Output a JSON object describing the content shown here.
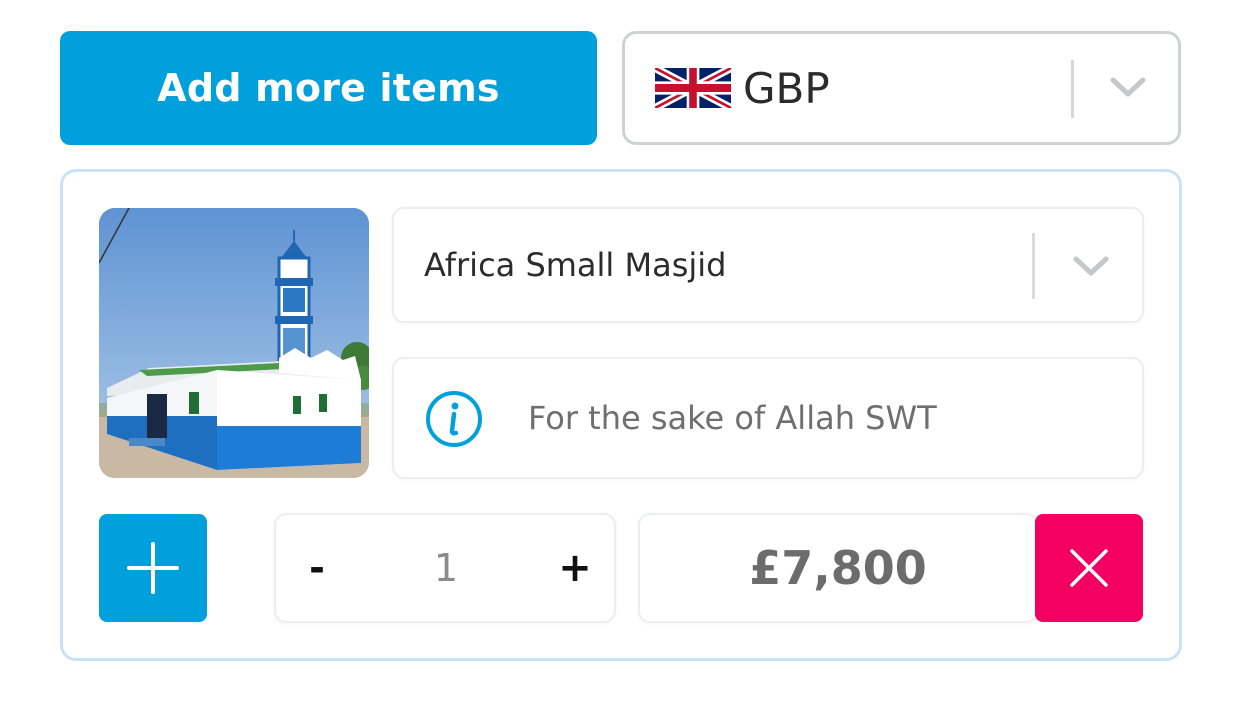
{
  "actions": {
    "add_more_label": "Add more items"
  },
  "currency": {
    "selected": "GBP",
    "flag_icon": "uk-flag-icon"
  },
  "item": {
    "image_icon": "masjid-photo",
    "product": "Africa Small Masjid",
    "note": "For the sake of Allah SWT",
    "quantity": "1",
    "minus_label": "-",
    "plus_label": "+",
    "amount": "£7,800"
  },
  "colors": {
    "primary": "#00a0dc",
    "danger": "#f40062",
    "card_border": "#c8e3f8"
  }
}
